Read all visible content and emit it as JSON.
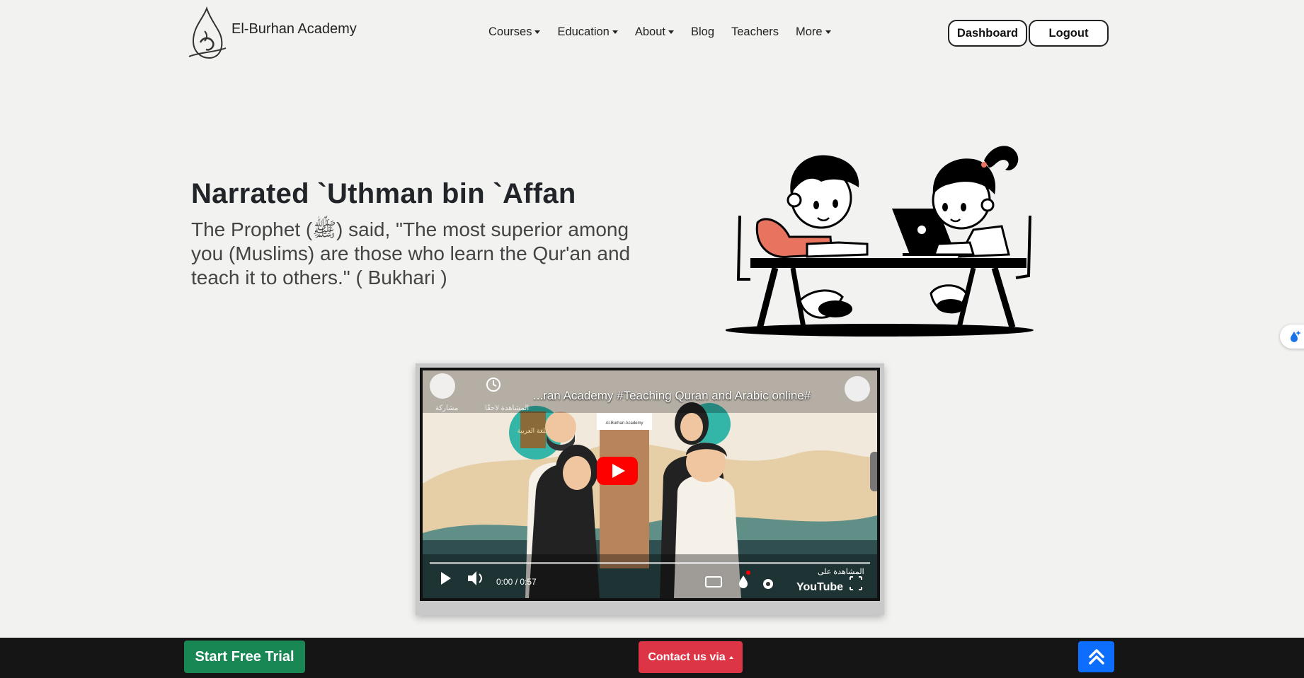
{
  "brand": {
    "name": "El-Burhan Academy",
    "logo_icon": "calligraphy-logo-icon"
  },
  "nav": {
    "items": [
      {
        "label": "Courses",
        "dropdown": true
      },
      {
        "label": "Education",
        "dropdown": true
      },
      {
        "label": "About",
        "dropdown": true
      },
      {
        "label": "Blog",
        "dropdown": false
      },
      {
        "label": "Teachers",
        "dropdown": false
      },
      {
        "label": "More",
        "dropdown": true
      }
    ],
    "dashboard_label": "Dashboard",
    "logout_label": "Logout"
  },
  "hero": {
    "title": "Narrated `Uthman bin `Affan",
    "text": "The Prophet (ﷺ) said, \"The most superior among you (Muslims) are those who learn the Qur'an and teach it to others.\" ( Bukhari )"
  },
  "video": {
    "title": "...ran Academy #Teaching Quran and Arabic online#",
    "share_label": "مشاركة",
    "watch_later_label": "المشاهدة لاحقًا",
    "time": "0:00 / 0:57",
    "watch_on_label": "المشاهدة على",
    "youtube_label": "YouTube",
    "sign_label": "اللغة العربية",
    "building_label": "Al-Burhan Academy"
  },
  "bottom": {
    "trial_label": "Start Free Trial",
    "contact_label": "Contact us via",
    "top_icon": "double-chevron-up-icon"
  },
  "colors": {
    "trial": "#198754",
    "contact": "#dc3545",
    "top": "#0d6efd",
    "bar": "#151515"
  }
}
